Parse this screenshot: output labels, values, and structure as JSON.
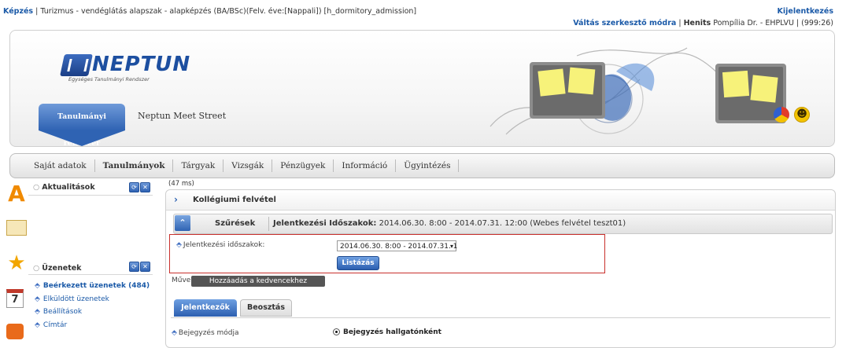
{
  "topbar": {
    "crumb_link": "Képzés",
    "crumb_sep": "|",
    "crumb_text": "Turizmus - vendéglátás alapszak - alapképzés (BA/BSc)(Felv. éve:[Nappali]) [h_dormitory_admission]",
    "logout": "Kijelentkezés",
    "switch_editor": "Váltás szerkesztő módra",
    "user_name": "Henits",
    "user_rest": "Pompília Dr. - EHPLVU",
    "session": "(999:26)"
  },
  "header": {
    "logo_text": "NEPTUN",
    "logo_sub": "Egységes Tanulmányi Rendszer",
    "tab_system": "Tanulmányi rendszer",
    "tab_meet": "Neptun Meet Street"
  },
  "menu": {
    "items": [
      "Saját adatok",
      "Tanulmányok",
      "Tárgyak",
      "Vizsgák",
      "Pénzügyek",
      "Információ",
      "Ügyintézés"
    ]
  },
  "sidebar": {
    "news_title": "Aktualitások",
    "messages_title": "Üzenetek",
    "messages": [
      "Beérkezett üzenetek (484)",
      "Elküldött üzenetek",
      "Beállítások",
      "Címtár"
    ]
  },
  "main": {
    "timing": "(47 ms)",
    "title": "Kollégiumi felvétel",
    "filter_title": "Szűrések",
    "filter_info_label": "Jelentkezési Időszakok:",
    "filter_info_value": "2014.06.30. 8:00 - 2014.07.31. 12:00 (Webes felvétel teszt01)",
    "period_label": "Jelentkezési időszakok:",
    "period_selected": "2014.06.30. 8:00 - 2014.07.31. 1",
    "list_button": "Listázás",
    "actions_label": "Műveletek:",
    "fav_button": "Hozzáadás a kedvencekhez",
    "tabs": [
      "Jelentkezők",
      "Beosztás"
    ],
    "mode_label": "Bejegyzés módja",
    "mode_option": "Bejegyzés hallgatónként"
  },
  "colors": {
    "accent_blue": "#2f63b3",
    "link_blue": "#1b5aa8",
    "highlight_red": "#c9302c"
  }
}
